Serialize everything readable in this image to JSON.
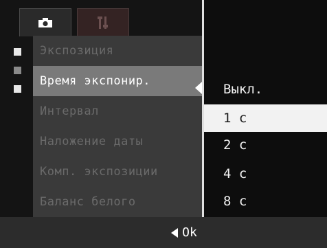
{
  "tabs": [
    {
      "icon": "camera-icon"
    },
    {
      "icon": "setup-tools-icon"
    }
  ],
  "menu": {
    "items": [
      {
        "label": "Экспозиция",
        "active": false
      },
      {
        "label": "Время экспонир.",
        "active": true
      },
      {
        "label": "Интервал",
        "active": false
      },
      {
        "label": "Наложение даты",
        "active": false
      },
      {
        "label": "Комп. экспозиции",
        "active": false
      },
      {
        "label": "Баланс белого",
        "active": false
      }
    ]
  },
  "submenu": {
    "options": [
      {
        "label": "Выкл.",
        "selected": false
      },
      {
        "label": "1 с",
        "selected": true
      },
      {
        "label": "2 с",
        "selected": false
      },
      {
        "label": "4 с",
        "selected": false
      },
      {
        "label": "8 с",
        "selected": false
      }
    ]
  },
  "footer": {
    "ok_label": "Ok"
  },
  "colors": {
    "active_row": "#7a7a7a",
    "selected_option": "#f2f2f2",
    "background": "#141414"
  }
}
